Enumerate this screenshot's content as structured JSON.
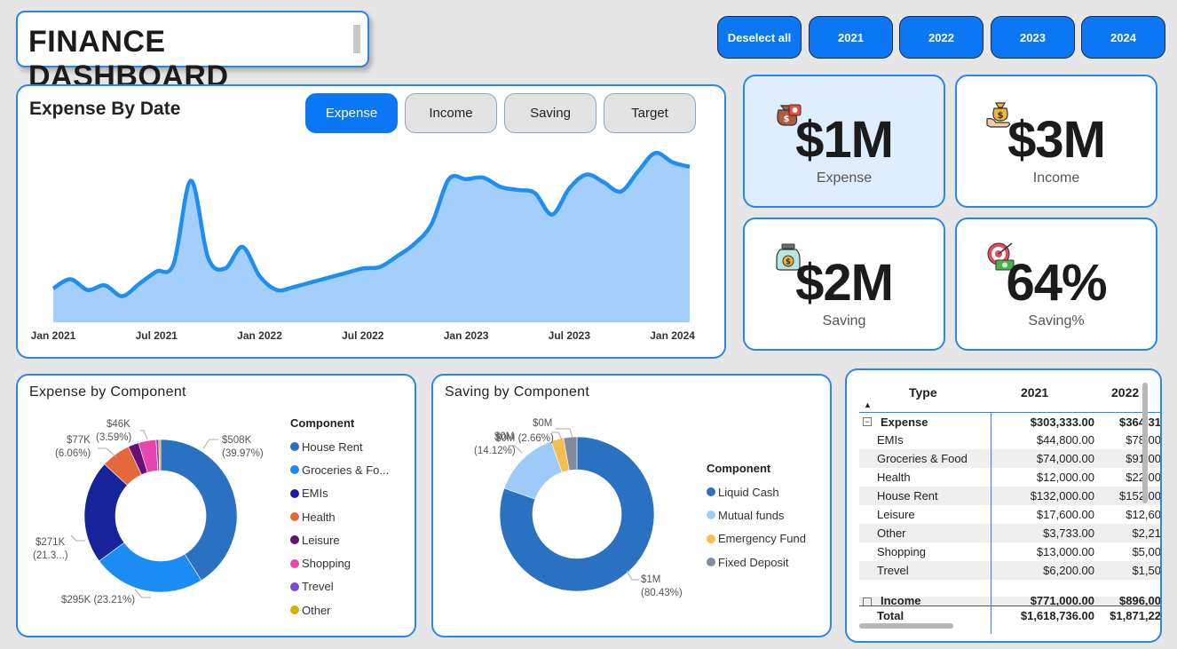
{
  "header": {
    "title": "FINANCE DASHBOARD"
  },
  "year_filters": [
    "Deselect all",
    "2021",
    "2022",
    "2023",
    "2024"
  ],
  "line_chart_panel": {
    "title": "Expense By Date",
    "measure_buttons": [
      "Expense",
      "Income",
      "Saving",
      "Target"
    ],
    "active_measure": "Expense"
  },
  "kpis": [
    {
      "value": "$1M",
      "label": "Expense",
      "icon": "money-bag-card-icon"
    },
    {
      "value": "$3M",
      "label": "Income",
      "icon": "hand-money-bag-icon"
    },
    {
      "value": "$2M",
      "label": "Saving",
      "icon": "savings-jar-icon"
    },
    {
      "value": "64%",
      "label": "Saving%",
      "icon": "target-cash-icon"
    }
  ],
  "expense_component": {
    "title": "Expense by Component",
    "legend_title": "Component",
    "legend": [
      "House Rent",
      "Groceries & Fo...",
      "EMIs",
      "Health",
      "Leisure",
      "Shopping",
      "Trevel",
      "Other"
    ],
    "data_labels": [
      {
        "value": "$508K",
        "pct": "(39.97%)"
      },
      {
        "value": "$295K (23.21%)",
        "pct": ""
      },
      {
        "value": "$271K",
        "pct": "(21.3...)"
      },
      {
        "value": "$77K",
        "pct": "(6.06%)"
      },
      {
        "value": "$46K",
        "pct": "(3.59%)"
      }
    ]
  },
  "saving_component": {
    "title": "Saving by Component",
    "legend_title": "Component",
    "legend": [
      "Liquid Cash",
      "Mutual funds",
      "Emergency Fund",
      "Fixed Deposit"
    ],
    "data_labels": [
      {
        "value": "$1M",
        "pct": "(80.43%)"
      },
      {
        "value": "$0M",
        "pct": "(14.12%)"
      },
      {
        "value": "$0M (2.66%)",
        "pct": ""
      },
      {
        "value": "$0M",
        "pct": ""
      }
    ]
  },
  "matrix": {
    "headers": [
      "Type",
      "2021",
      "2022"
    ],
    "rows": [
      {
        "name": "Expense",
        "v2021": "$303,333.00",
        "v2022": "$364,31",
        "bold": true,
        "group": true
      },
      {
        "name": "EMIs",
        "v2021": "$44,800.00",
        "v2022": "$78,00"
      },
      {
        "name": "Groceries & Food",
        "v2021": "$74,000.00",
        "v2022": "$91,00"
      },
      {
        "name": "Health",
        "v2021": "$12,000.00",
        "v2022": "$22,00"
      },
      {
        "name": "House Rent",
        "v2021": "$132,000.00",
        "v2022": "$152,00"
      },
      {
        "name": "Leisure",
        "v2021": "$17,600.00",
        "v2022": "$12,60"
      },
      {
        "name": "Other",
        "v2021": "$3,733.00",
        "v2022": "$2,21"
      },
      {
        "name": "Shopping",
        "v2021": "$13,000.00",
        "v2022": "$5,00"
      },
      {
        "name": "Trevel",
        "v2021": "$6,200.00",
        "v2022": "$1,50"
      }
    ],
    "partial_row": {
      "name": "Income",
      "v2021": "$771,000.00",
      "v2022": "$896,00"
    },
    "total": {
      "name": "Total",
      "v2021": "$1,618,736.00",
      "v2022": "$1,871,22"
    }
  },
  "chart_data": [
    {
      "type": "area",
      "title": "Expense By Date",
      "x_ticks": [
        "Jan 2021",
        "Jul 2021",
        "Jan 2022",
        "Jul 2022",
        "Jan 2023",
        "Jul 2023",
        "Jan 2024"
      ],
      "x": [
        "2021-01",
        "2021-02",
        "2021-03",
        "2021-04",
        "2021-05",
        "2021-06",
        "2021-07",
        "2021-08",
        "2021-09",
        "2021-10",
        "2021-11",
        "2021-12",
        "2022-01",
        "2022-02",
        "2022-03",
        "2022-04",
        "2022-05",
        "2022-06",
        "2022-07",
        "2022-08",
        "2022-09",
        "2022-10",
        "2022-11",
        "2022-12",
        "2023-01",
        "2023-02",
        "2023-03",
        "2023-04",
        "2023-05",
        "2023-06",
        "2023-07",
        "2023-08",
        "2023-09",
        "2023-10",
        "2023-11",
        "2023-12",
        "2024-01",
        "2024-02"
      ],
      "values": [
        22000,
        28000,
        21000,
        24000,
        17000,
        25000,
        33000,
        38000,
        92000,
        42000,
        35000,
        49000,
        30000,
        21000,
        23000,
        26000,
        29000,
        32000,
        35000,
        36000,
        43000,
        51000,
        64000,
        93000,
        93000,
        94000,
        88000,
        86000,
        84000,
        70000,
        87000,
        96000,
        91000,
        85000,
        98000,
        110000,
        104000,
        101000
      ],
      "color": "#1f8ef1",
      "fill": "#a3cffa"
    },
    {
      "type": "pie",
      "title": "Expense by Component",
      "categories": [
        "House Rent",
        "Groceries & Food",
        "EMIs",
        "Health",
        "Leisure",
        "Shopping",
        "Trevel",
        "Other"
      ],
      "values": [
        508000,
        295000,
        271000,
        77000,
        28000,
        46000,
        7000,
        5000
      ],
      "colors": [
        "#2a71c1",
        "#1a8cf3",
        "#16239b",
        "#e5683a",
        "#6a0f77",
        "#e646ae",
        "#7c4bd3",
        "#d4b009"
      ]
    },
    {
      "type": "pie",
      "title": "Saving by Component",
      "categories": [
        "Liquid Cash",
        "Mutual funds",
        "Emergency Fund",
        "Fixed Deposit"
      ],
      "values": [
        80.43,
        14.12,
        2.66,
        2.79
      ],
      "colors": [
        "#2a71c1",
        "#9fcbfa",
        "#f4bf4f",
        "#7f8c9e"
      ]
    }
  ]
}
